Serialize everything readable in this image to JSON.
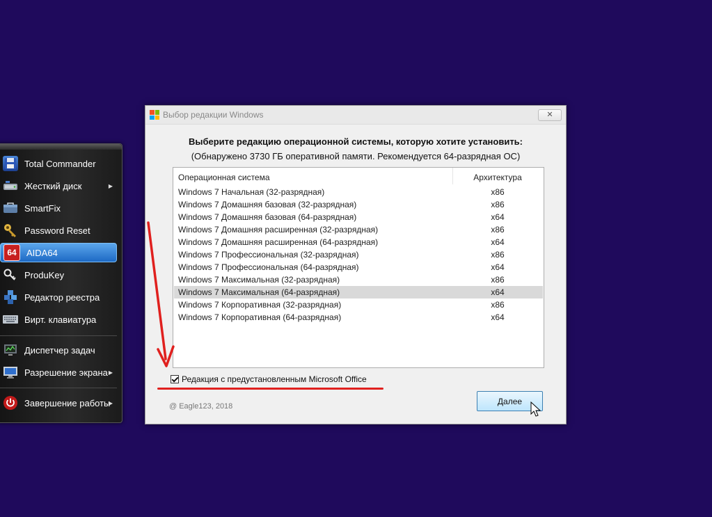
{
  "colors": {
    "desktop_bg": "#1f0a5c",
    "accent_red": "#e0201e",
    "selection_blue": "#1d69c4"
  },
  "launcher": {
    "items": [
      {
        "label": "Total Commander",
        "icon": "floppy-disk-icon",
        "has_submenu": false
      },
      {
        "label": "Жесткий диск",
        "icon": "hard-disk-icon",
        "has_submenu": true
      },
      {
        "label": "SmartFix",
        "icon": "smartfix-toolbox-icon",
        "has_submenu": false
      },
      {
        "label": "Password Reset",
        "icon": "key-icon",
        "has_submenu": false
      },
      {
        "label": "AIDA64",
        "icon": "aida64-icon",
        "icon_text": "64",
        "has_submenu": false,
        "selected": true
      },
      {
        "label": "ProduKey",
        "icon": "produkey-key-icon",
        "has_submenu": false
      },
      {
        "label": "Редактор реестра",
        "icon": "registry-cubes-icon",
        "has_submenu": false
      },
      {
        "label": "Вирт. клавиатура",
        "icon": "keyboard-icon",
        "has_submenu": false
      },
      {
        "label": "Диспетчер задач",
        "icon": "task-manager-icon",
        "has_submenu": false
      },
      {
        "label": "Разрешение экрана",
        "icon": "monitor-icon",
        "has_submenu": true
      },
      {
        "label": "Завершение работы",
        "icon": "power-icon",
        "has_submenu": true
      }
    ]
  },
  "dialog": {
    "title": "Выбор редакции Windows",
    "close_glyph": "✕",
    "heading": "Выберите редакцию операционной системы, которую хотите установить:",
    "subheading": "(Обнаружено 3730 ГБ оперативной памяти. Рекомендуется 64-разрядная ОС)",
    "columns": {
      "os": "Операционная система",
      "arch": "Архитектура"
    },
    "rows": [
      {
        "os": "Windows 7 Начальная (32-разрядная)",
        "arch": "x86"
      },
      {
        "os": "Windows 7 Домашняя базовая (32-разрядная)",
        "arch": "x86"
      },
      {
        "os": "Windows 7 Домашняя базовая (64-разрядная)",
        "arch": "x64"
      },
      {
        "os": "Windows 7 Домашняя расширенная (32-разрядная)",
        "arch": "x86"
      },
      {
        "os": "Windows 7 Домашняя расширенная (64-разрядная)",
        "arch": "x64"
      },
      {
        "os": "Windows 7 Профессиональная (32-разрядная)",
        "arch": "x86"
      },
      {
        "os": "Windows 7 Профессиональная (64-разрядная)",
        "arch": "x64"
      },
      {
        "os": "Windows 7 Максимальная (32-разрядная)",
        "arch": "x86"
      },
      {
        "os": "Windows 7 Максимальная (64-разрядная)",
        "arch": "x64",
        "selected": true
      },
      {
        "os": "Windows 7 Корпоративная (32-разрядная)",
        "arch": "x86"
      },
      {
        "os": "Windows 7 Корпоративная (64-разрядная)",
        "arch": "x64"
      }
    ],
    "checkbox": {
      "label": "Редакция с предустановленным Microsoft Office",
      "checked": true
    },
    "copyright": "@ Eagle123, 2018",
    "next_label": "Далее"
  }
}
